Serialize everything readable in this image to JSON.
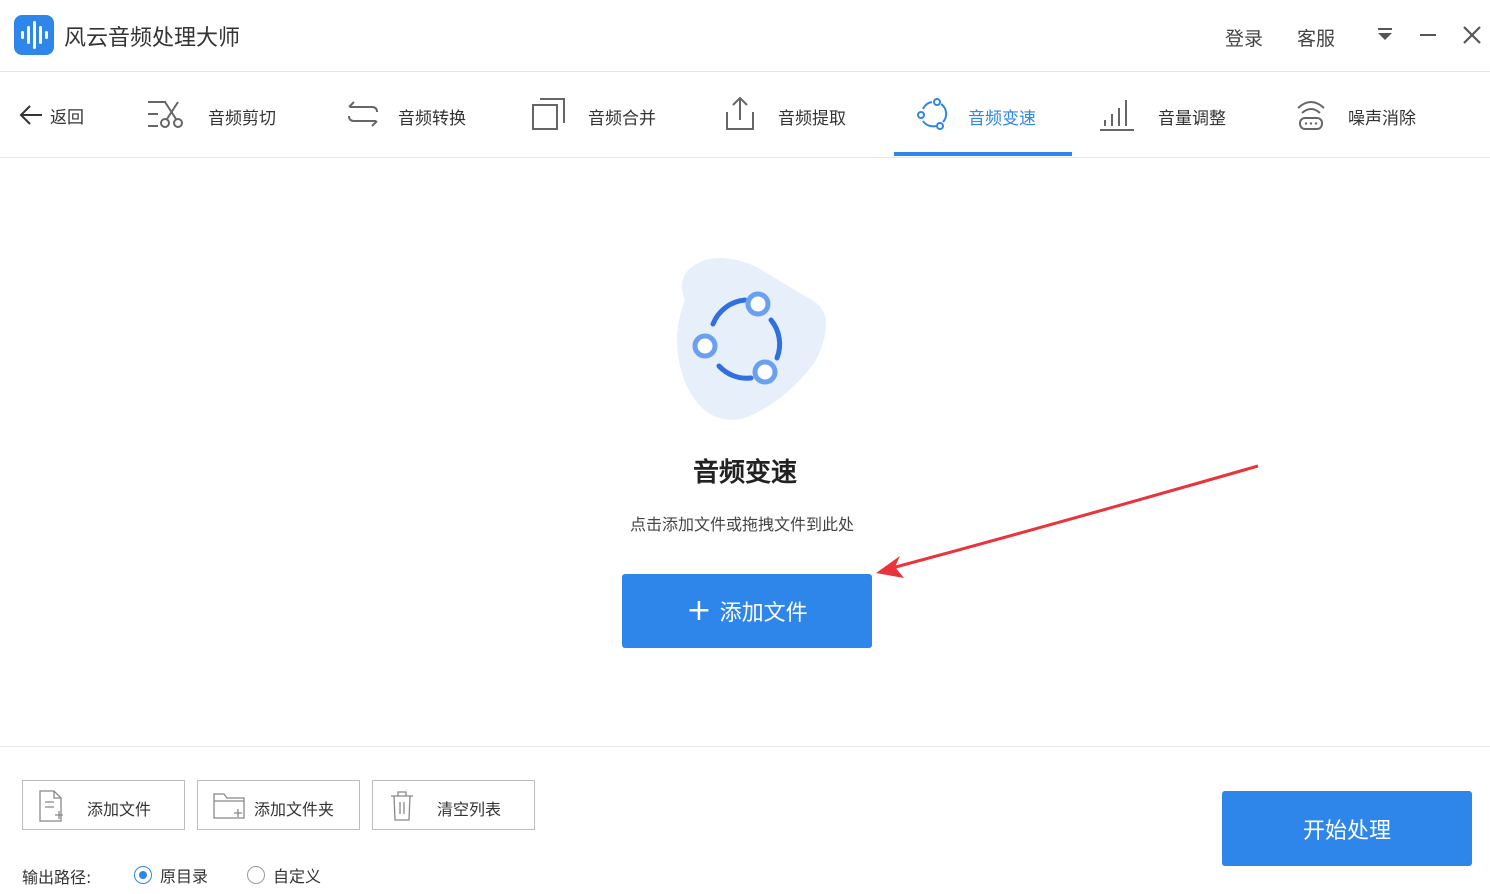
{
  "window": {
    "title": "风云音频处理大师",
    "login": "登录",
    "support": "客服"
  },
  "nav": {
    "back_label": "返回",
    "tabs": [
      {
        "label": "音频剪切",
        "icon": "scissors-icon"
      },
      {
        "label": "音频转换",
        "icon": "convert-arrows-icon"
      },
      {
        "label": "音频合并",
        "icon": "merge-squares-icon"
      },
      {
        "label": "音频提取",
        "icon": "upload-extract-icon"
      },
      {
        "label": "音频变速",
        "icon": "speed-circle-icon",
        "active": true
      },
      {
        "label": "音量调整",
        "icon": "volume-bars-icon"
      },
      {
        "label": "噪声消除",
        "icon": "noise-wifi-icon"
      }
    ]
  },
  "main": {
    "title": "音频变速",
    "hint": "点击添加文件或拖拽文件到此处",
    "add_button": "添加文件",
    "add_button_icon": "plus-icon"
  },
  "toolbar": {
    "add_file": "添加文件",
    "add_folder": "添加文件夹",
    "clear_list": "清空列表",
    "start": "开始处理"
  },
  "output": {
    "label": "输出路径:",
    "options": [
      {
        "label": "原目录",
        "selected": true
      },
      {
        "label": "自定义",
        "selected": false
      }
    ]
  },
  "colors": {
    "accent": "#2f86ea",
    "hero_bg": "#e7effb",
    "annotation_arrow": "#e8343a"
  }
}
